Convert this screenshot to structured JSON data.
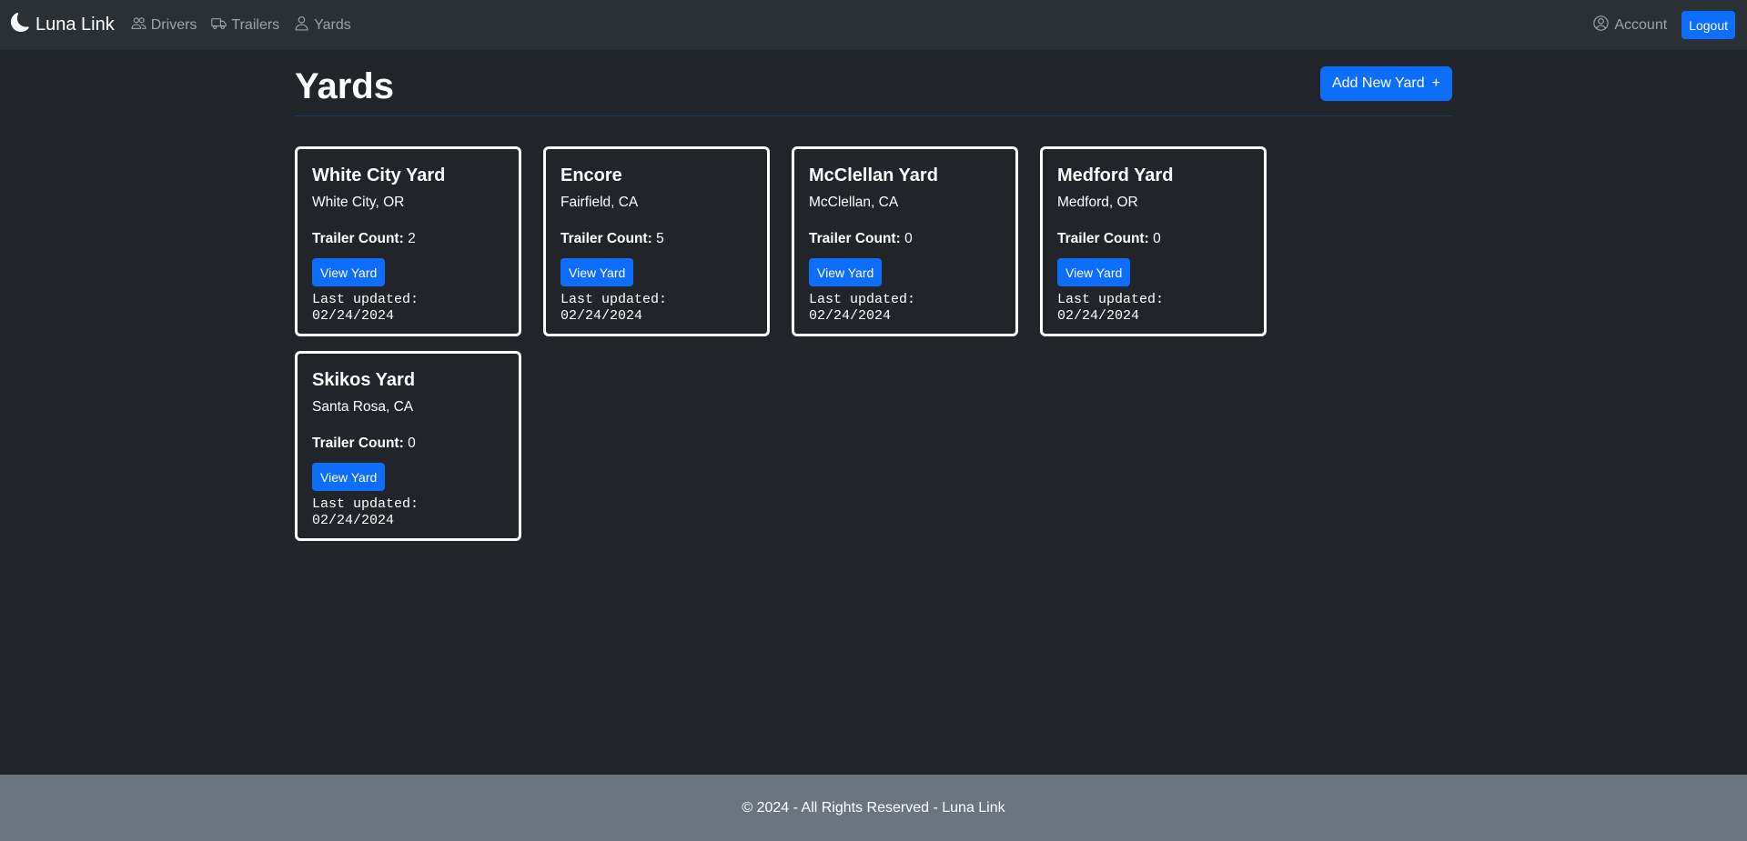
{
  "navbar": {
    "brand": "Luna Link",
    "links": [
      {
        "label": "Drivers",
        "icon": "people-icon"
      },
      {
        "label": "Trailers",
        "icon": "truck-icon"
      },
      {
        "label": "Yards",
        "icon": "person-icon"
      }
    ],
    "account_label": "Account",
    "logout_label": "Logout"
  },
  "page": {
    "title": "Yards",
    "add_button_label": "Add New Yard",
    "add_button_icon": "+"
  },
  "yards": [
    {
      "name": "White City Yard",
      "location": "White City, OR",
      "count_label": "Trailer Count:",
      "count": "2",
      "view_label": "View Yard",
      "updated": "Last updated: 02/24/2024"
    },
    {
      "name": "Encore",
      "location": "Fairfield, CA",
      "count_label": "Trailer Count:",
      "count": "5",
      "view_label": "View Yard",
      "updated": "Last updated: 02/24/2024"
    },
    {
      "name": "McClellan Yard",
      "location": "McClellan, CA",
      "count_label": "Trailer Count:",
      "count": "0",
      "view_label": "View Yard",
      "updated": "Last updated: 02/24/2024"
    },
    {
      "name": "Medford Yard",
      "location": "Medford, OR",
      "count_label": "Trailer Count:",
      "count": "0",
      "view_label": "View Yard",
      "updated": "Last updated: 02/24/2024"
    },
    {
      "name": "Skikos Yard",
      "location": "Santa Rosa, CA",
      "count_label": "Trailer Count:",
      "count": "0",
      "view_label": "View Yard",
      "updated": "Last updated: 02/24/2024"
    }
  ],
  "footer": {
    "text": "© 2024 - All Rights Reserved - Luna Link"
  },
  "colors": {
    "primary": "#0d6efd",
    "background": "#212529",
    "navbar": "#2b3035",
    "footer": "#6c757d"
  }
}
